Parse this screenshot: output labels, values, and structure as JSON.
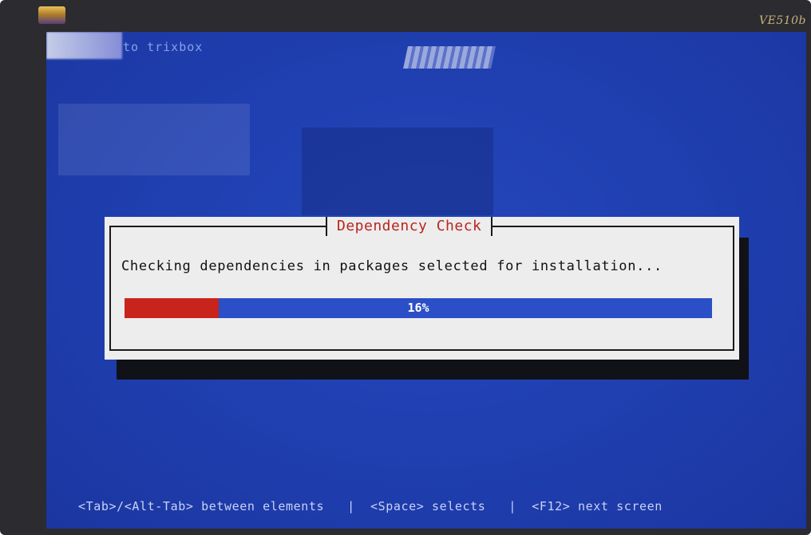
{
  "window": {
    "top_title": "to trixbox",
    "monitor_model": "VE510b"
  },
  "dialog": {
    "title": "Dependency Check",
    "message": "Checking dependencies in packages selected for installation...",
    "progress": {
      "percent": 16,
      "label": "16%"
    }
  },
  "status_bar": {
    "text": "<Tab>/<Alt-Tab> between elements   |  <Space> selects   |  <F12> next screen"
  },
  "colors": {
    "screen_background": "#2040b2",
    "dialog_background": "#ededed",
    "dialog_title": "#b8261e",
    "progress_fill": "#c8241c",
    "progress_track": "#2b4fc6"
  }
}
